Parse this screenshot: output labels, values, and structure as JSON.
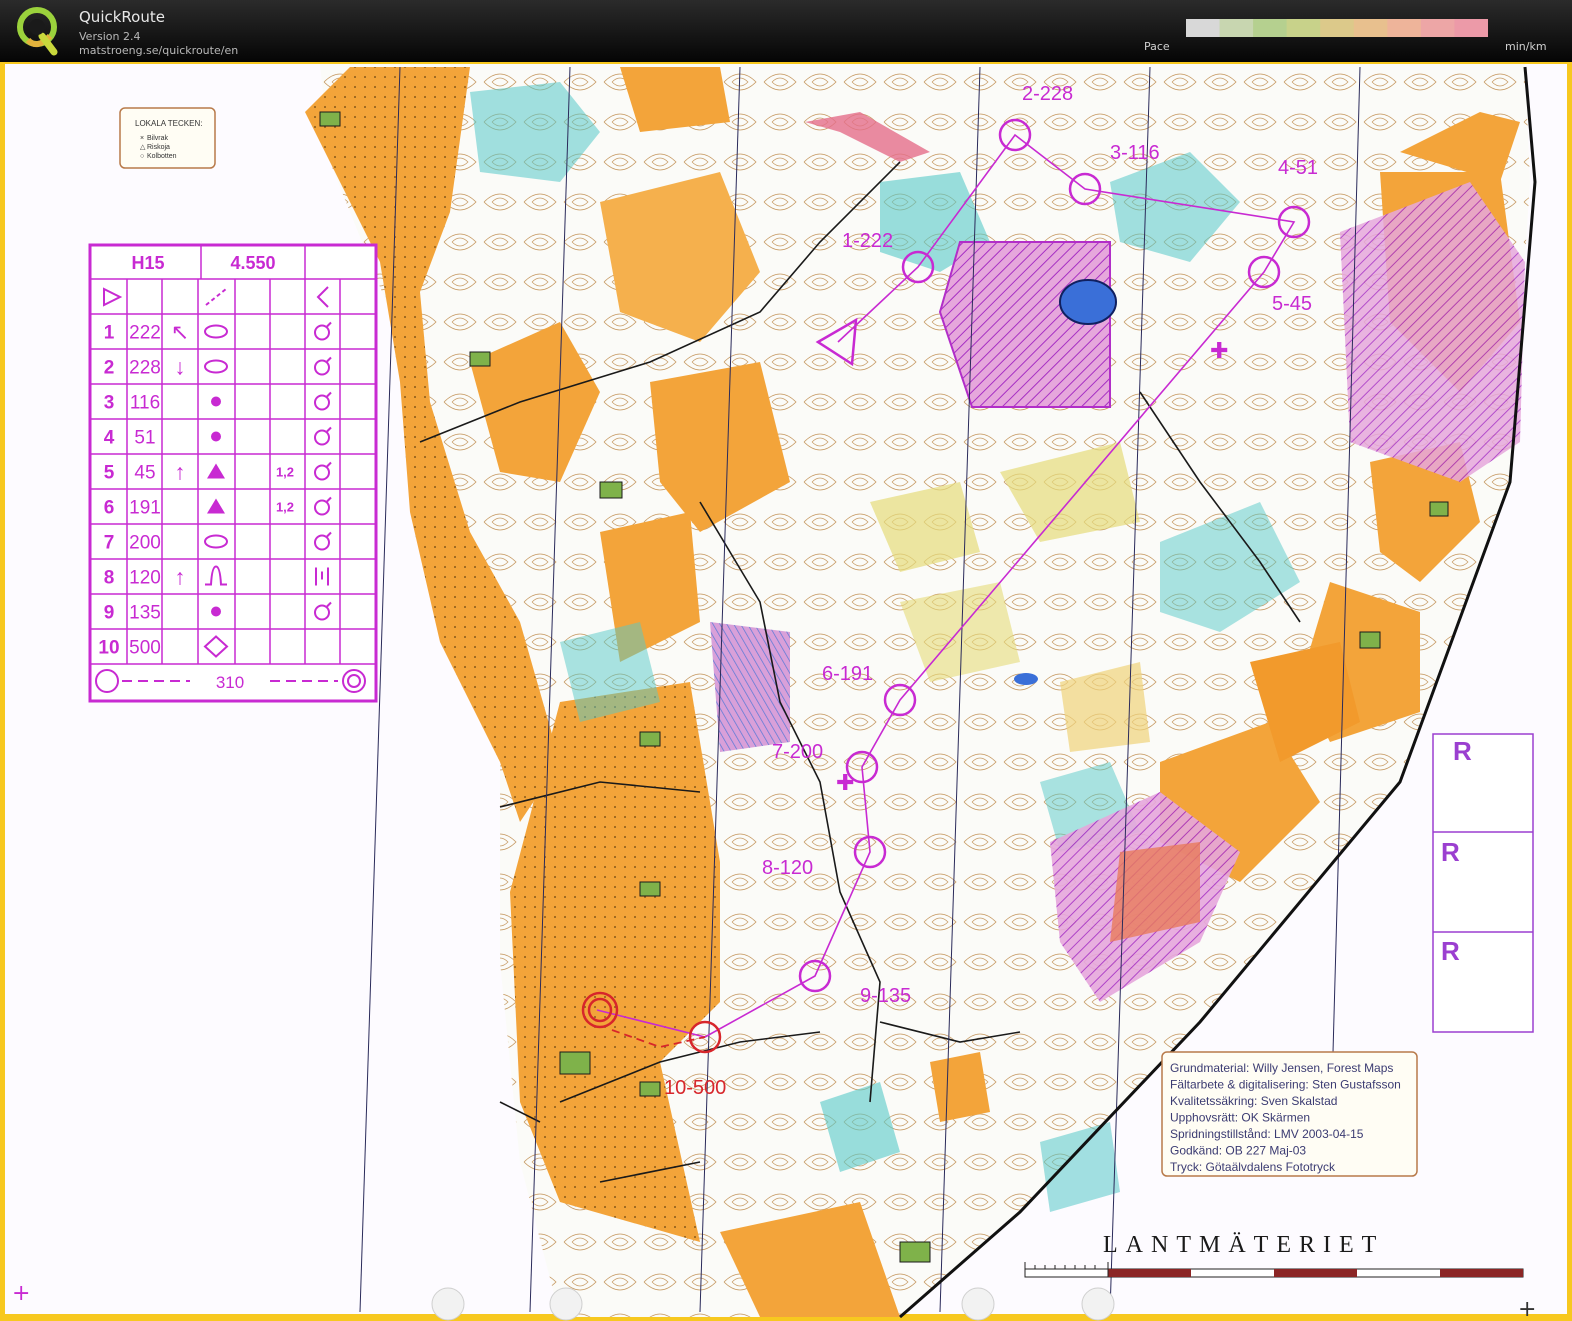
{
  "app": {
    "title": "QuickRoute",
    "version": "Version 2.4",
    "url": "matstroeng.se/quickroute/en",
    "pace_label": "Pace",
    "pace_unit": "min/km",
    "pace_colors": [
      "#d8d8d8",
      "#c8d6b0",
      "#b5d08f",
      "#c8d28a",
      "#dcc98a",
      "#e8c08e",
      "#eeb49a",
      "#eda6a6",
      "#ec9aa8"
    ]
  },
  "map": {
    "legend_box": {
      "title": "LOKALA TECKEN:",
      "items": [
        "Bilvrak",
        "Riskoja",
        "Kolbotten"
      ]
    },
    "control_card": {
      "class": "H15",
      "length": "4.550",
      "rows": [
        {
          "num": "1",
          "code": "222",
          "dir": "↖",
          "feature": "ellipse",
          "dim": "",
          "loc": "ring"
        },
        {
          "num": "2",
          "code": "228",
          "dir": "↓",
          "feature": "ellipse",
          "dim": "",
          "loc": "ring"
        },
        {
          "num": "3",
          "code": "116",
          "dir": "",
          "feature": "dot",
          "dim": "",
          "loc": "ring"
        },
        {
          "num": "4",
          "code": "51",
          "dir": "",
          "feature": "dot",
          "dim": "",
          "loc": "ring"
        },
        {
          "num": "5",
          "code": "45",
          "dir": "↑",
          "feature": "triangle",
          "dim": "1,2",
          "loc": "ring"
        },
        {
          "num": "6",
          "code": "191",
          "dir": "",
          "feature": "triangle",
          "dim": "1,2",
          "loc": "ring"
        },
        {
          "num": "7",
          "code": "200",
          "dir": "",
          "feature": "ellipse",
          "dim": "",
          "loc": "ring"
        },
        {
          "num": "8",
          "code": "120",
          "dir": "↑",
          "feature": "hump",
          "dim": "",
          "loc": "bars"
        },
        {
          "num": "9",
          "code": "135",
          "dir": "",
          "feature": "dot",
          "dim": "",
          "loc": "ring"
        },
        {
          "num": "10",
          "code": "500",
          "dir": "",
          "feature": "diamond",
          "dim": "",
          "loc": ""
        }
      ],
      "finish_distance": "310"
    },
    "controls": [
      {
        "label": "1-222"
      },
      {
        "label": "2-228"
      },
      {
        "label": "3-116"
      },
      {
        "label": "4-51"
      },
      {
        "label": "5-45"
      },
      {
        "label": "6-191"
      },
      {
        "label": "7-200"
      },
      {
        "label": "8-120"
      },
      {
        "label": "9-135"
      },
      {
        "label": "10-500"
      }
    ],
    "credits": [
      "Grundmaterial: Willy Jensen, Forest Maps",
      "Fältarbete & digitalisering: Sten Gustafsson",
      "Kvalitetssäkring: Sven Skalstad",
      "Upphovsrätt: OK Skärmen",
      "Spridningstillstånd: LMV 2003-04-15",
      "Godkänd: OB 227 Maj-03",
      "Tryck: Götaälvdalens Fototryck"
    ],
    "publisher": "LANTMÄTERIET",
    "r_marks": [
      "R",
      "R",
      "R"
    ],
    "colors": {
      "course_purple": "#c82ad2",
      "open_orange": "#f3a43a",
      "forest_white": "#fbfbf8",
      "green_water": "#56c9c8",
      "finish_red": "#d7262b",
      "map_edge_yellow": "#f7c81f"
    }
  }
}
